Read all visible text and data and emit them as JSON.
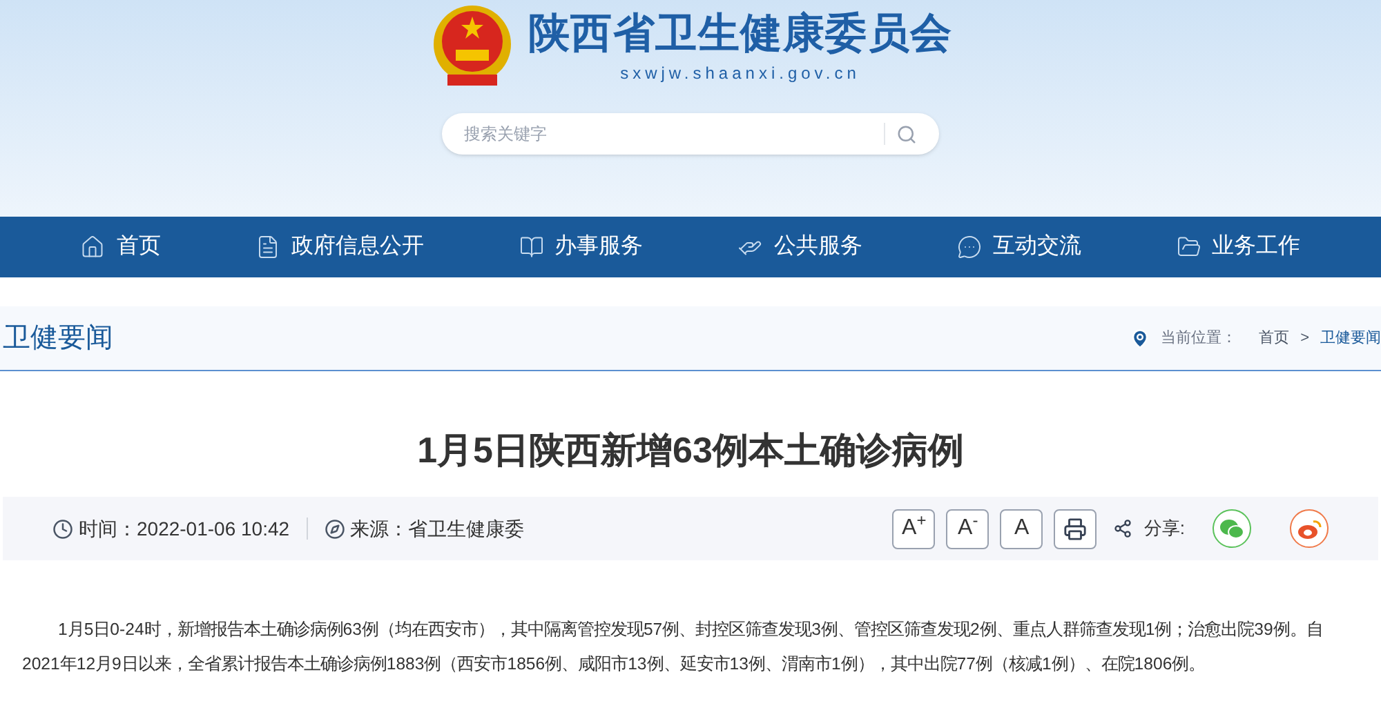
{
  "header": {
    "site_name": "陕西省卫生健康委员会",
    "domain": "sxwjw.shaanxi.gov.cn",
    "search": {
      "placeholder": "搜索关键字"
    }
  },
  "nav": [
    {
      "label": "首页"
    },
    {
      "label": "政府信息公开"
    },
    {
      "label": "办事服务"
    },
    {
      "label": "公共服务"
    },
    {
      "label": "互动交流"
    },
    {
      "label": "业务工作"
    }
  ],
  "section": {
    "title": "卫健要闻",
    "location_label": "当前位置：",
    "breadcrumb": [
      "首页",
      ">",
      "卫健要闻"
    ]
  },
  "article": {
    "title": "1月5日陕西新增63例本土确诊病例",
    "time": "时间：2022-01-06 10:42",
    "source": "来源：省卫生健康委",
    "font_buttons": [
      "A$^{+}$",
      "A$^{-}$",
      "A"
    ],
    "share_label": "分享:",
    "body": "1月5日0-24时，新增报告本土确诊病例63例（均在西安市），其中隔离管控发现57例、封控区筛查发现3例、管控区筛查发现2例、重点人群筛查发现1例；治愈出院39例。自2021年12月9日以来，全省累计报告本土确诊病例1883例（西安市1856例、咸阳市13例、延安市13例、渭南市1例），其中出院77例（核减1例）、在院1806例。"
  }
}
